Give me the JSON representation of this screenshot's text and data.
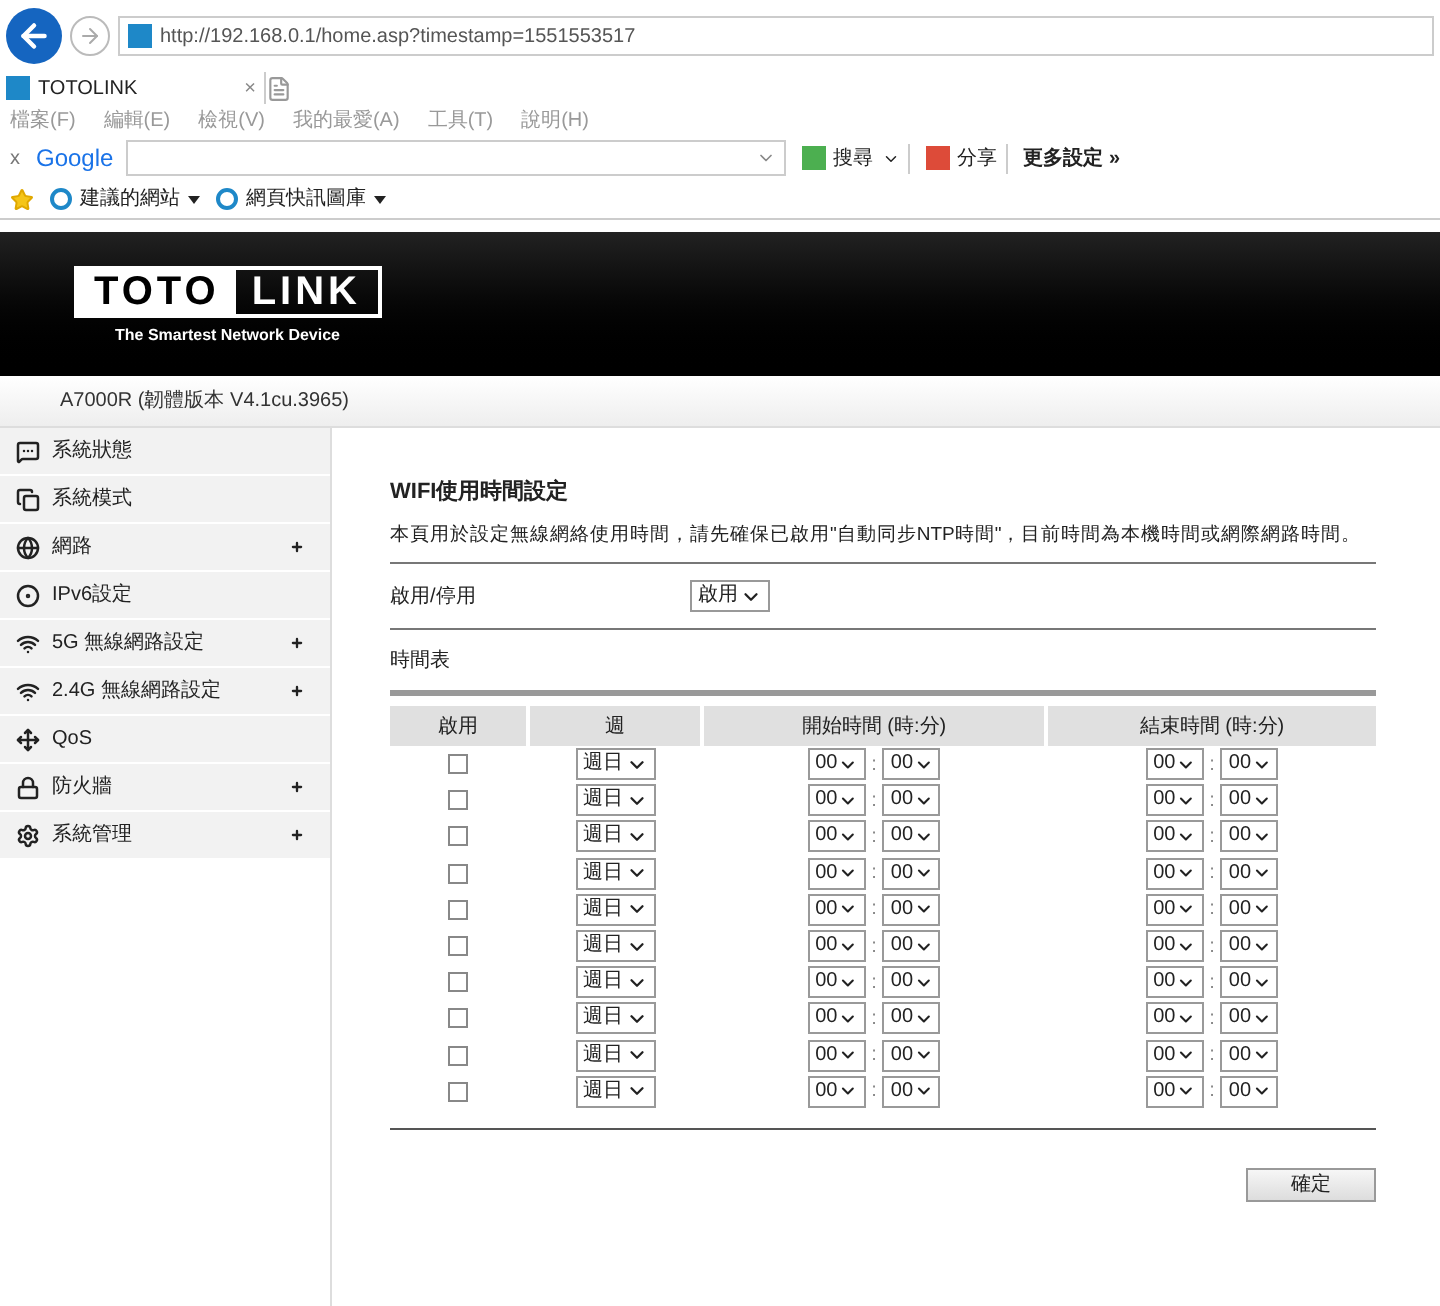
{
  "browser": {
    "url": "http://192.168.0.1/home.asp?timestamp=1551553517",
    "tab": {
      "title": "TOTOLINK",
      "close": "×"
    },
    "menu": [
      "檔案(F)",
      "編輯(E)",
      "檢視(V)",
      "我的最愛(A)",
      "工具(T)",
      "說明(H)"
    ],
    "toolbar": {
      "close": "x",
      "logo": "Google",
      "search_button": "搜尋",
      "share": "分享",
      "more": "更多設定 »"
    },
    "favorites": [
      "建議的網站",
      "網頁快訊圖庫"
    ]
  },
  "header": {
    "logo_left": "TOTO",
    "logo_right": "LINK",
    "tagline": "The Smartest Network Device",
    "model": "A7000R (韌體版本 V4.1cu.3965)"
  },
  "sidebar": {
    "items": [
      {
        "label": "系統狀態",
        "expandable": false
      },
      {
        "label": "系統模式",
        "expandable": false
      },
      {
        "label": "網路",
        "expandable": true
      },
      {
        "label": "IPv6設定",
        "expandable": false
      },
      {
        "label": "5G 無線網路設定",
        "expandable": true
      },
      {
        "label": "2.4G 無線網路設定",
        "expandable": true
      },
      {
        "label": "QoS",
        "expandable": false
      },
      {
        "label": "防火牆",
        "expandable": true
      },
      {
        "label": "系統管理",
        "expandable": true
      }
    ]
  },
  "content": {
    "title": "WIFI使用時間設定",
    "description": "本頁用於設定無線網絡使用時間，請先確保已啟用\"自動同步NTP時間\"，目前時間為本機時間或網際網路時間。",
    "enable_label": "啟用/停用",
    "enable_value": "啟用",
    "schedule_title": "時間表",
    "columns": [
      "啟用",
      "週",
      "開始時間 (時:分)",
      "結束時間 (時:分)"
    ],
    "separator": ":",
    "rows": [
      {
        "checked": false,
        "day": "週日",
        "start_hour": "00",
        "start_min": "00",
        "end_hour": "00",
        "end_min": "00"
      },
      {
        "checked": false,
        "day": "週日",
        "start_hour": "00",
        "start_min": "00",
        "end_hour": "00",
        "end_min": "00"
      },
      {
        "checked": false,
        "day": "週日",
        "start_hour": "00",
        "start_min": "00",
        "end_hour": "00",
        "end_min": "00"
      },
      {
        "checked": false,
        "day": "週日",
        "start_hour": "00",
        "start_min": "00",
        "end_hour": "00",
        "end_min": "00"
      },
      {
        "checked": false,
        "day": "週日",
        "start_hour": "00",
        "start_min": "00",
        "end_hour": "00",
        "end_min": "00"
      },
      {
        "checked": false,
        "day": "週日",
        "start_hour": "00",
        "start_min": "00",
        "end_hour": "00",
        "end_min": "00"
      },
      {
        "checked": false,
        "day": "週日",
        "start_hour": "00",
        "start_min": "00",
        "end_hour": "00",
        "end_min": "00"
      },
      {
        "checked": false,
        "day": "週日",
        "start_hour": "00",
        "start_min": "00",
        "end_hour": "00",
        "end_min": "00"
      },
      {
        "checked": false,
        "day": "週日",
        "start_hour": "00",
        "start_min": "00",
        "end_hour": "00",
        "end_min": "00"
      },
      {
        "checked": false,
        "day": "週日",
        "start_hour": "00",
        "start_min": "00",
        "end_hour": "00",
        "end_min": "00"
      }
    ],
    "submit": "確定"
  }
}
